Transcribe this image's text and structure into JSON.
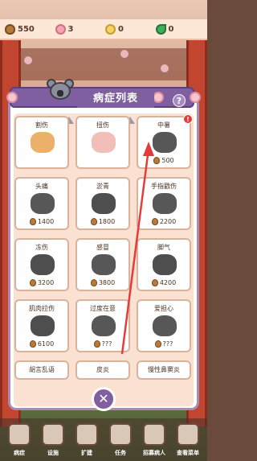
{
  "status_bar": {
    "acorns": "550",
    "flowers": "3",
    "coins": "0",
    "leaves": "0",
    "icons": [
      "acorn-icon",
      "flower-icon",
      "coin-icon",
      "leaf-icon"
    ]
  },
  "dialog": {
    "title": "病症列表",
    "help_label": "?",
    "close_label": "✕"
  },
  "ailments": [
    {
      "name": "割伤",
      "cost": "",
      "icon": "bandage-icon"
    },
    {
      "name": "扭伤",
      "cost": "",
      "icon": "twisted-ankle-icon"
    },
    {
      "name": "中暑",
      "cost": "500",
      "icon": "sun-icon",
      "alert": "!"
    },
    {
      "name": "头痛",
      "cost": "1400",
      "icon": "headache-icon"
    },
    {
      "name": "淤青",
      "cost": "1800",
      "icon": "bruise-icon"
    },
    {
      "name": "手指戳伤",
      "cost": "2200",
      "icon": "finger-icon"
    },
    {
      "name": "冻伤",
      "cost": "3200",
      "icon": "frostbite-icon"
    },
    {
      "name": "感冒",
      "cost": "3800",
      "icon": "cold-pot-icon"
    },
    {
      "name": "脚气",
      "cost": "4200",
      "icon": "foot-icon"
    },
    {
      "name": "肌肉拉伤",
      "cost": "6100",
      "icon": "muscle-icon"
    },
    {
      "name": "过度在意",
      "cost": "???",
      "icon": "silhouette-icon"
    },
    {
      "name": "爱担心",
      "cost": "???",
      "icon": "silhouette-icon"
    },
    {
      "name": "胡言乱语",
      "cost": "",
      "icon": ""
    },
    {
      "name": "皮炎",
      "cost": "",
      "icon": ""
    },
    {
      "name": "慢性鼻窦炎",
      "cost": "",
      "icon": ""
    }
  ],
  "bottom_nav": [
    {
      "label": "病症"
    },
    {
      "label": "设施"
    },
    {
      "label": "扩建"
    },
    {
      "label": "任务"
    },
    {
      "label": "招募病人"
    },
    {
      "label": "查看菜单"
    }
  ],
  "colors": {
    "accent": "#7f5fa0",
    "panel_bg": "#fbe1d2",
    "annotation_arrow": "#e53b3b"
  }
}
